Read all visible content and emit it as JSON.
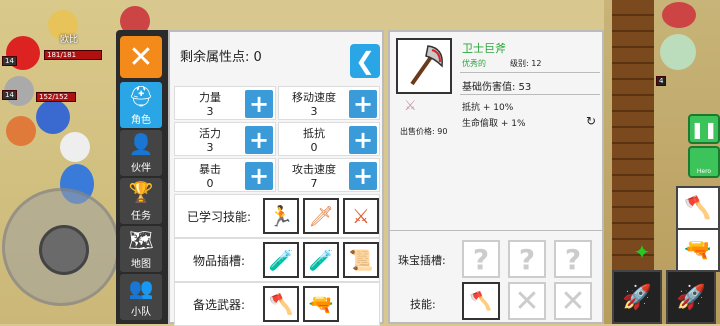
{
  "hud": {
    "unit_name": "欧比",
    "unit_level": "14",
    "unit_hp": "181/181",
    "unit2_level": "14",
    "unit2_hp": "152/152",
    "unit_tag": "4"
  },
  "sidenav": {
    "close_label": "✕",
    "items": [
      {
        "label": "角色",
        "icon": "⛑"
      },
      {
        "label": "伙伴",
        "icon": "👤"
      },
      {
        "label": "任务",
        "icon": "🏆"
      },
      {
        "label": "地图",
        "icon": "🗺"
      },
      {
        "label": "小队",
        "icon": "👥"
      }
    ]
  },
  "attributes": {
    "remaining_label": "剩余属性点: 0",
    "stats": [
      {
        "name": "力量",
        "value": "3"
      },
      {
        "name": "移动速度",
        "value": "3"
      },
      {
        "name": "活力",
        "value": "3"
      },
      {
        "name": "抵抗",
        "value": "0"
      },
      {
        "name": "暴击",
        "value": "0"
      },
      {
        "name": "攻击速度",
        "value": "7"
      }
    ],
    "plus": "+",
    "learned_skills_label": "已学习技能:",
    "item_slots_label": "物品插槽:",
    "backup_weapon_label": "备选武器:"
  },
  "weapon": {
    "name": "卫士巨斧",
    "quality": "优秀的",
    "level": "级别: 12",
    "base_damage": "基础伤害值: 53",
    "effects": [
      "抵抗 + 10%",
      "生命偷取 + 1%"
    ],
    "sell_price": "出售价格: 90",
    "gem_slots_label": "珠宝插槽:",
    "skills_label": "技能:",
    "empty_slot": "?"
  },
  "controls": {
    "pause": "❚❚",
    "hero": "Hero"
  },
  "colors": {
    "accent_blue": "#2aa6e6",
    "close_orange": "#f38a1a",
    "quality_green": "#2aa63a"
  }
}
